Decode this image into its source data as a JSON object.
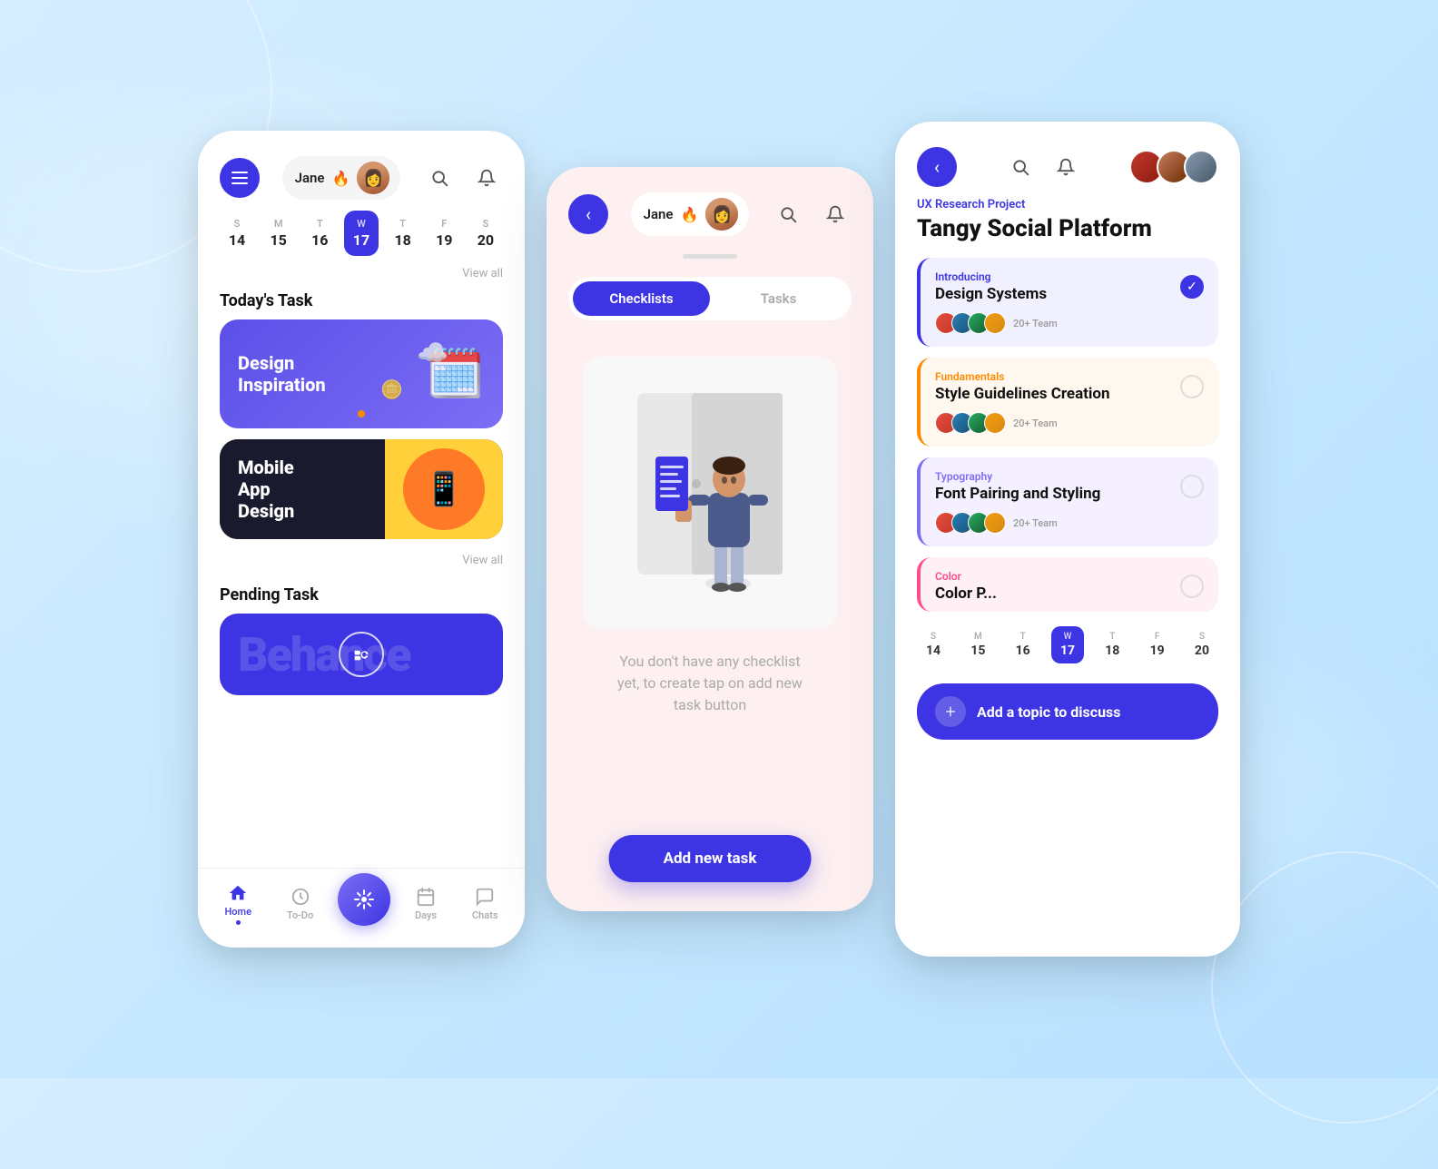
{
  "background": {
    "color": "#c8e8ff"
  },
  "left_phone": {
    "menu_label": "Menu",
    "user_name": "Jane",
    "user_emoji": "🔥",
    "search_label": "Search",
    "notification_label": "Notifications",
    "calendar": {
      "days": [
        {
          "letter": "S",
          "num": "14",
          "active": false
        },
        {
          "letter": "M",
          "num": "15",
          "active": false
        },
        {
          "letter": "T",
          "num": "16",
          "active": false
        },
        {
          "letter": "W",
          "num": "17",
          "active": true
        },
        {
          "letter": "T",
          "num": "18",
          "active": false
        },
        {
          "letter": "F",
          "num": "19",
          "active": false
        },
        {
          "letter": "S",
          "num": "20",
          "active": false
        }
      ],
      "view_all": "View all"
    },
    "today_task_title": "Today's Task",
    "tasks": [
      {
        "title": "Design Inspiration",
        "bg": "purple"
      },
      {
        "title": "Mobile App Design",
        "bg": "dark"
      }
    ],
    "view_all": "View all",
    "pending_task_title": "Pending Task",
    "pending_task_name": "Behance",
    "nav": {
      "items": [
        {
          "label": "Home",
          "active": true
        },
        {
          "label": "To-Do",
          "active": false
        },
        {
          "label": "Days",
          "active": false
        },
        {
          "label": "Chats",
          "active": false
        }
      ]
    }
  },
  "middle_phone": {
    "back_label": "Back",
    "user_name": "Jane",
    "user_emoji": "🔥",
    "tabs": [
      {
        "label": "Checklists",
        "active": true
      },
      {
        "label": "Tasks",
        "active": false
      }
    ],
    "empty_message": "You don't have any checklist yet, to create tap on add new task button",
    "add_task_btn": "Add new task",
    "divider": ""
  },
  "right_phone": {
    "back_label": "Back",
    "project_category": "UX Research Project",
    "project_title": "Tangy Social Platform",
    "tasks": [
      {
        "subtitle": "Introducing",
        "subtitle_color": "blue",
        "name": "Design Systems",
        "team": "20+ Team",
        "checked": true
      },
      {
        "subtitle": "Fundamentals",
        "subtitle_color": "orange",
        "name": "Style Guidelines Creation",
        "team": "20+ Team",
        "checked": false
      },
      {
        "subtitle": "Typography",
        "subtitle_color": "purple",
        "name": "Font Pairing and Styling",
        "team": "20+ Team",
        "checked": false
      },
      {
        "subtitle": "Color",
        "subtitle_color": "pink",
        "name": "Color P...",
        "team": "",
        "checked": false
      }
    ],
    "calendar": {
      "days": [
        {
          "letter": "S",
          "num": "14",
          "active": false
        },
        {
          "letter": "M",
          "num": "15",
          "active": false
        },
        {
          "letter": "T",
          "num": "16",
          "active": false
        },
        {
          "letter": "W",
          "num": "17",
          "active": true
        },
        {
          "letter": "T",
          "num": "18",
          "active": false
        },
        {
          "letter": "F",
          "num": "19",
          "active": false
        },
        {
          "letter": "S",
          "num": "20",
          "active": false
        }
      ]
    },
    "add_topic_btn": "Add a topic to discuss"
  }
}
